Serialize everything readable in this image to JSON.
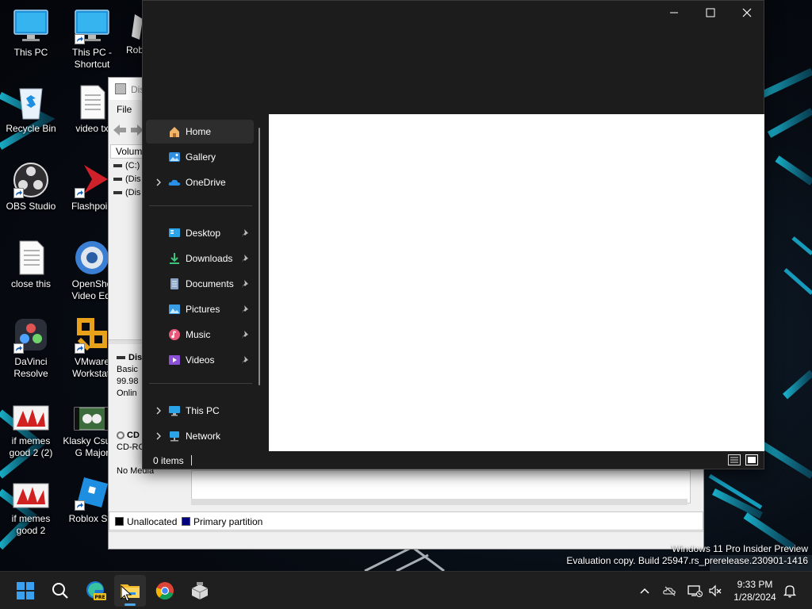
{
  "desktop": {
    "icons": [
      {
        "label": "This PC",
        "icon": "monitor-icon"
      },
      {
        "label": "This PC - Shortcut",
        "icon": "monitor-icon"
      },
      {
        "label": "Rob",
        "icon": "roblox-icon"
      },
      {
        "label": "Recycle Bin",
        "icon": "recycle-bin-icon"
      },
      {
        "label": "video tx",
        "icon": "text-file-icon"
      },
      {
        "label": "OBS Studio",
        "icon": "obs-icon"
      },
      {
        "label": "Flashpoin",
        "icon": "flashpoint-icon"
      },
      {
        "label": "close this",
        "icon": "text-file-icon"
      },
      {
        "label": "OpenSho Video Edi",
        "icon": "openshot-icon"
      },
      {
        "label": "DaVinci Resolve",
        "icon": "davinci-icon"
      },
      {
        "label": "VMware Workstati",
        "icon": "vmware-icon"
      },
      {
        "label": "if memes good 2 (2)",
        "icon": "image-file-icon"
      },
      {
        "label": "Klasky Csu In G Major",
        "icon": "video-file-icon"
      },
      {
        "label": "if memes good 2",
        "icon": "image-file-icon"
      },
      {
        "label": "Roblox Stu",
        "icon": "roblox-studio-icon"
      }
    ]
  },
  "disk_management": {
    "title": "Dis",
    "menu_file": "File",
    "volume_header": "Volum",
    "volumes": [
      "(C:)",
      "(Dis",
      "(Dis"
    ],
    "disk0": {
      "name": "Dis",
      "type": "Basic",
      "size": "99.98",
      "state": "Onlin"
    },
    "cdrom": {
      "name": "CD",
      "type": "CD-RO",
      "media": "No Media"
    },
    "legend": [
      {
        "label": "Unallocated",
        "color": "#000000"
      },
      {
        "label": "Primary partition",
        "color": "#00007f"
      }
    ]
  },
  "explorer": {
    "caption": {
      "minimize": "—",
      "maximize": "☐",
      "close": "✕"
    },
    "nav_top": [
      {
        "label": "Home",
        "icon": "home-icon",
        "selected": true,
        "expandable": false
      },
      {
        "label": "Gallery",
        "icon": "gallery-icon",
        "selected": false,
        "expandable": false
      },
      {
        "label": "OneDrive",
        "icon": "onedrive-icon",
        "selected": false,
        "expandable": true
      }
    ],
    "nav_pinned": [
      {
        "label": "Desktop",
        "icon": "desktop-folder-icon"
      },
      {
        "label": "Downloads",
        "icon": "downloads-icon"
      },
      {
        "label": "Documents",
        "icon": "documents-icon"
      },
      {
        "label": "Pictures",
        "icon": "pictures-icon"
      },
      {
        "label": "Music",
        "icon": "music-icon"
      },
      {
        "label": "Videos",
        "icon": "videos-icon"
      }
    ],
    "nav_bottom": [
      {
        "label": "This PC",
        "icon": "this-pc-icon"
      },
      {
        "label": "Network",
        "icon": "network-icon"
      }
    ],
    "status": "0 items"
  },
  "watermark": {
    "line1": "Windows 11 Pro Insider Preview",
    "line2": "Evaluation copy. Build 25947.rs_prerelease.230901-1416"
  },
  "taskbar": {
    "apps": [
      "start-icon",
      "search-icon",
      "edge-beta-icon",
      "file-explorer-icon",
      "chrome-icon",
      "vm-tools-icon"
    ],
    "active_app": "file-explorer-icon",
    "time": "9:33 PM",
    "date": "1/28/2024"
  },
  "colors": {
    "accent": "#4fa9e8",
    "explorer_bg": "#1c1c1c",
    "taskbar_bg": "#1f1f1f"
  }
}
